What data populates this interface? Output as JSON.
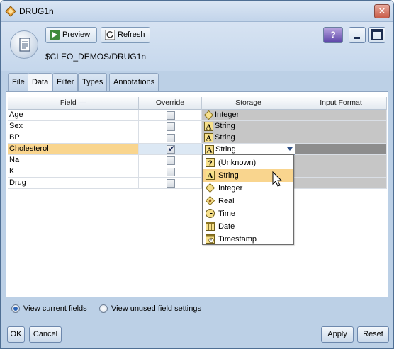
{
  "window": {
    "title": "DRUG1n"
  },
  "toolbar": {
    "preview_label": "Preview",
    "refresh_label": "Refresh",
    "help_label": "?"
  },
  "header": {
    "path": "$CLEO_DEMOS/DRUG1n"
  },
  "tabs": [
    {
      "label": "File"
    },
    {
      "label": "Data",
      "active": true
    },
    {
      "label": "Filter"
    },
    {
      "label": "Types"
    },
    {
      "label": "Annotations"
    }
  ],
  "table": {
    "columns": [
      "Field",
      "Override",
      "Storage",
      "Input Format"
    ],
    "rows": [
      {
        "field": "Age",
        "override": false,
        "storage": "Integer",
        "storage_icon": "integer-icon"
      },
      {
        "field": "Sex",
        "override": false,
        "storage": "String",
        "storage_icon": "string-icon"
      },
      {
        "field": "BP",
        "override": false,
        "storage": "String",
        "storage_icon": "string-icon"
      },
      {
        "field": "Cholesterol",
        "override": true,
        "storage": "String",
        "storage_icon": "string-icon",
        "selected": true
      },
      {
        "field": "Na",
        "override": false,
        "storage": "",
        "storage_icon": ""
      },
      {
        "field": "K",
        "override": false,
        "storage": "",
        "storage_icon": ""
      },
      {
        "field": "Drug",
        "override": false,
        "storage": "",
        "storage_icon": ""
      }
    ]
  },
  "storage_dropdown": {
    "options": [
      {
        "label": "(Unknown)",
        "icon": "unknown-icon"
      },
      {
        "label": "String",
        "icon": "string-icon",
        "highlighted": true
      },
      {
        "label": "Integer",
        "icon": "integer-icon"
      },
      {
        "label": "Real",
        "icon": "real-icon"
      },
      {
        "label": "Time",
        "icon": "time-icon"
      },
      {
        "label": "Date",
        "icon": "date-icon"
      },
      {
        "label": "Timestamp",
        "icon": "timestamp-icon"
      }
    ]
  },
  "view_options": {
    "current_label": "View current fields",
    "unused_label": "View unused field settings",
    "selected": "current"
  },
  "buttons": {
    "ok": "OK",
    "cancel": "Cancel",
    "apply": "Apply",
    "reset": "Reset"
  },
  "colors": {
    "selection": "#f9d58e",
    "chrome": "#bcd0e6",
    "accent": "#2a63b6"
  }
}
